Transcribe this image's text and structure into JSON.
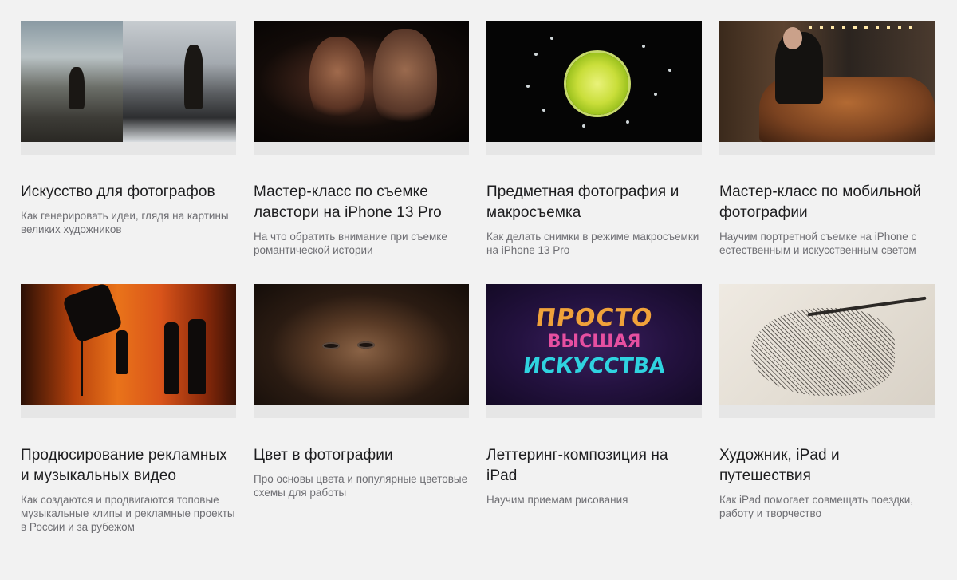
{
  "cards": [
    {
      "title": "Искусство для фотографов",
      "description": "Как генерировать идеи, глядя на картины великих художников"
    },
    {
      "title": "Мастер-класс по съемке лавстори на iPhone 13 Pro",
      "description": "На что обратить внимание при съемке романтической истории"
    },
    {
      "title": "Предметная фотография и макросъемка",
      "description": "Как делать снимки в режиме макросъемки на iPhone 13 Pro"
    },
    {
      "title": "Мастер-класс по мобильной фотографии",
      "description": "Научим портретной съемке на iPhone с естественным и искусственным светом"
    },
    {
      "title": "Продюсирование рекламных и музыкальных видео",
      "description": "Как создаются и продвигаются топовые музыкальные клипы и рекламные проекты в России и за рубежом"
    },
    {
      "title": "Цвет в фотографии",
      "description": "Про основы цвета и популярные цветовые схемы для работы"
    },
    {
      "title": "Леттеринг-композиция на iPad",
      "description": "Научим приемам рисования"
    },
    {
      "title": "Художник, iPad и путешествия",
      "description": "Как iPad помогает совмещать поездки, работу и творчество"
    }
  ],
  "lettering_art": {
    "line1": "ПРОСТО",
    "line2": "ВЫСШАЯ",
    "line3": "ИСКУССТВА"
  }
}
